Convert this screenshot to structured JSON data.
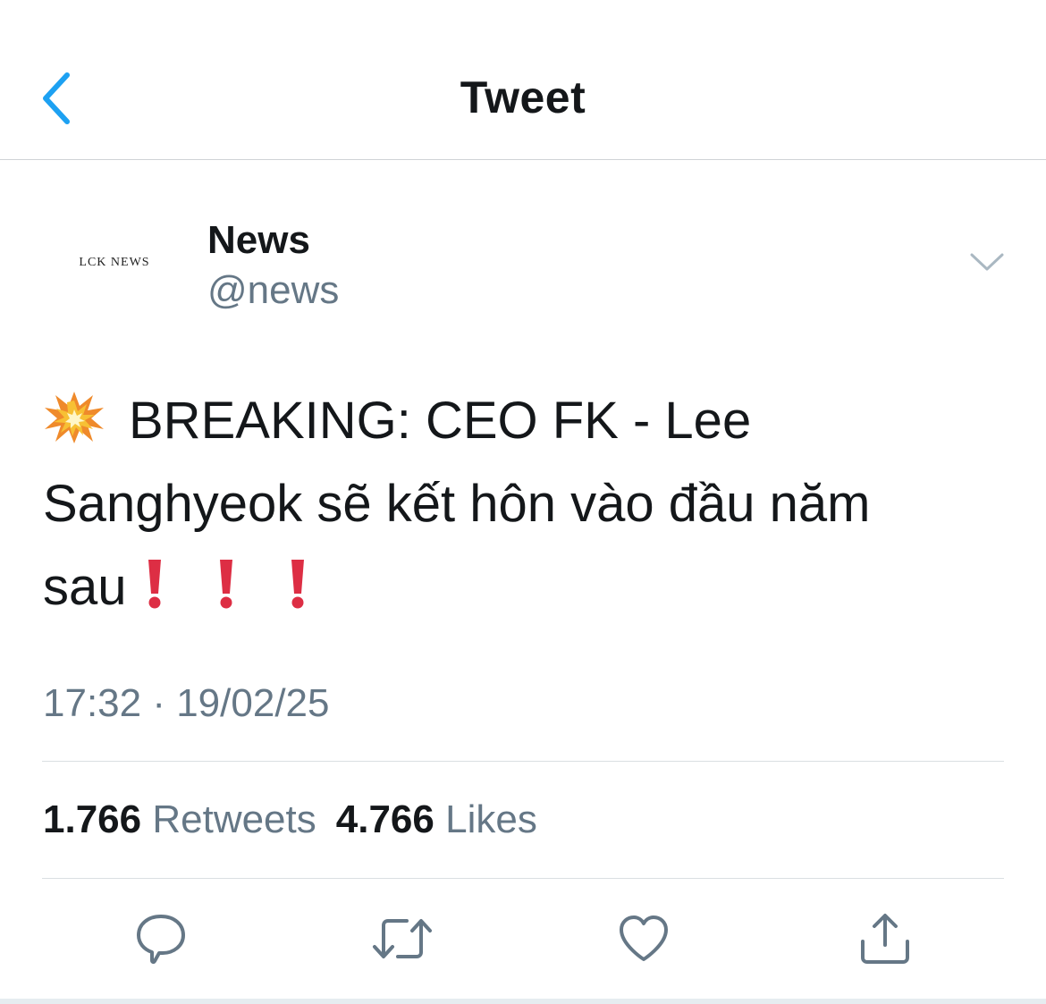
{
  "header": {
    "title": "Tweet",
    "back_icon": "chevron-left-icon"
  },
  "author": {
    "avatar_text": "LCK NEWS",
    "display_name": "News",
    "handle": "@news",
    "menu_icon": "chevron-down-icon"
  },
  "tweet": {
    "emoji": "collision-emoji",
    "text_line1": "BREAKING: CEO FK - Lee",
    "text_line2": "Sanghyeok sẽ kết hôn vào đầu năm",
    "text_line3": "sau",
    "trailing_emoji": "exclamation-mark-emoji",
    "timestamp": "17:32 · 19/02/25"
  },
  "stats": {
    "retweets_count": "1.766",
    "retweets_label": "Retweets",
    "likes_count": "4.766",
    "likes_label": "Likes"
  },
  "actions": [
    "reply-icon",
    "retweet-icon",
    "like-icon",
    "share-icon"
  ],
  "colors": {
    "accent": "#1da1f2",
    "text": "#14171a",
    "secondary": "#657786",
    "icon": "#657786",
    "exclamation": "#dd2e44"
  }
}
